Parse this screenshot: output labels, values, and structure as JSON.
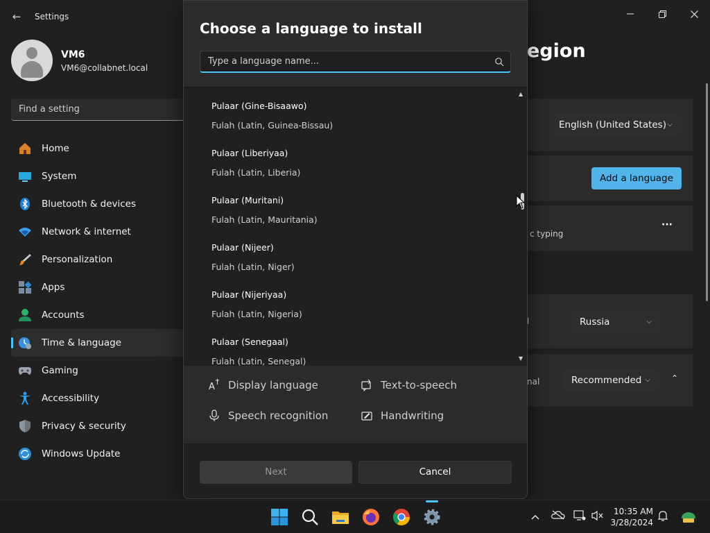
{
  "window": {
    "title": "Settings",
    "back_glyph": "←",
    "minimize_glyph": "—",
    "maximize_glyph": "❐",
    "close_glyph": "✕"
  },
  "profile": {
    "name": "VM6",
    "email": "VM6@collabnet.local"
  },
  "search_setting": {
    "placeholder": "Find a setting"
  },
  "nav": [
    {
      "label": "Home",
      "icon": "home-icon"
    },
    {
      "label": "System",
      "icon": "system-icon"
    },
    {
      "label": "Bluetooth & devices",
      "icon": "bluetooth-icon"
    },
    {
      "label": "Network & internet",
      "icon": "wifi-icon"
    },
    {
      "label": "Personalization",
      "icon": "brush-icon"
    },
    {
      "label": "Apps",
      "icon": "apps-icon"
    },
    {
      "label": "Accounts",
      "icon": "accounts-icon"
    },
    {
      "label": "Time & language",
      "icon": "time-language-icon",
      "active": true
    },
    {
      "label": "Gaming",
      "icon": "gaming-icon"
    },
    {
      "label": "Accessibility",
      "icon": "accessibility-icon"
    },
    {
      "label": "Privacy & security",
      "icon": "shield-icon"
    },
    {
      "label": "Windows Update",
      "icon": "update-icon"
    }
  ],
  "background_page": {
    "title_fragment": "egion",
    "display_language_value": "English (United States)",
    "add_language_label": "Add a language",
    "typing_fragment": "c typing",
    "more_glyph": "···",
    "country_value": "Russia",
    "regional_fragment": "nal",
    "region_format_value": "Recommended",
    "country_fragment_l": "l"
  },
  "dialog": {
    "title": "Choose a language to install",
    "search_placeholder": "Type a language name...",
    "languages": [
      {
        "name": "Pulaar (Gine-Bisaawo)",
        "sub": "Fulah (Latin, Guinea-Bissau)"
      },
      {
        "name": "Pulaar (Liberiyaa)",
        "sub": "Fulah (Latin, Liberia)"
      },
      {
        "name": "Pulaar (Muritani)",
        "sub": "Fulah (Latin, Mauritania)"
      },
      {
        "name": "Pulaar (Nijeer)",
        "sub": "Fulah (Latin, Niger)"
      },
      {
        "name": "Pulaar (Nijeriyaa)",
        "sub": "Fulah (Latin, Nigeria)"
      },
      {
        "name": "Pulaar (Senegaal)",
        "sub": "Fulah (Latin, Senegal)"
      }
    ],
    "features": {
      "display_language": "Display language",
      "text_to_speech": "Text-to-speech",
      "speech_recognition": "Speech recognition",
      "handwriting": "Handwriting"
    },
    "next_label": "Next",
    "cancel_label": "Cancel"
  },
  "taskbar": {
    "time": "10:35 AM",
    "date": "3/28/2024",
    "accent_color": "#4cc2ff"
  }
}
